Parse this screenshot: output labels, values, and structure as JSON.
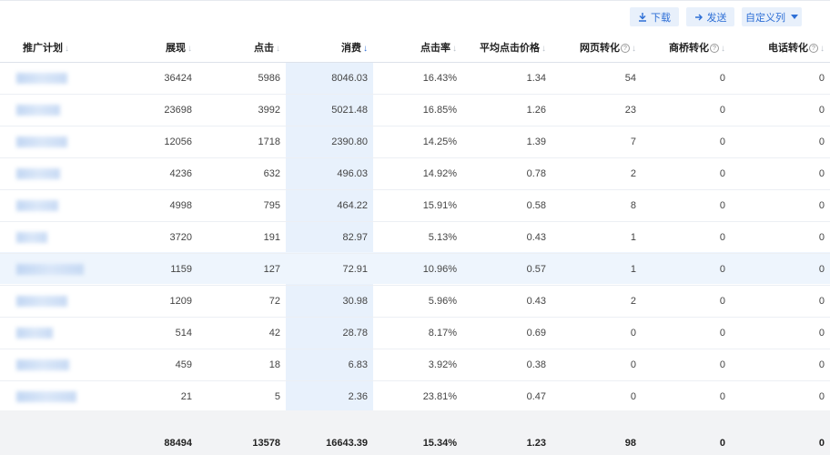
{
  "toolbar": {
    "download_label": "下载",
    "send_label": "发送",
    "custom_label": "自定义列"
  },
  "columns": [
    {
      "label": "推广计划",
      "help": false,
      "sort": "none"
    },
    {
      "label": "展现",
      "help": false,
      "sort": "none"
    },
    {
      "label": "点击",
      "help": false,
      "sort": "none"
    },
    {
      "label": "消费",
      "help": false,
      "sort": "desc"
    },
    {
      "label": "点击率",
      "help": false,
      "sort": "none"
    },
    {
      "label": "平均点击价格",
      "help": false,
      "sort": "none"
    },
    {
      "label": "网页转化",
      "help": true,
      "sort": "none"
    },
    {
      "label": "商桥转化",
      "help": true,
      "sort": "none"
    },
    {
      "label": "电话转化",
      "help": true,
      "sort": "none"
    }
  ],
  "rows": [
    [
      "",
      "36424",
      "5986",
      "8046.03",
      "16.43%",
      "1.34",
      "54",
      "0",
      "0"
    ],
    [
      "",
      "23698",
      "3992",
      "5021.48",
      "16.85%",
      "1.26",
      "23",
      "0",
      "0"
    ],
    [
      "",
      "12056",
      "1718",
      "2390.80",
      "14.25%",
      "1.39",
      "7",
      "0",
      "0"
    ],
    [
      "",
      "4236",
      "632",
      "496.03",
      "14.92%",
      "0.78",
      "2",
      "0",
      "0"
    ],
    [
      "",
      "4998",
      "795",
      "464.22",
      "15.91%",
      "0.58",
      "8",
      "0",
      "0"
    ],
    [
      "",
      "3720",
      "191",
      "82.97",
      "5.13%",
      "0.43",
      "1",
      "0",
      "0"
    ],
    [
      "",
      "1159",
      "127",
      "72.91",
      "10.96%",
      "0.57",
      "1",
      "0",
      "0"
    ],
    [
      "",
      "1209",
      "72",
      "30.98",
      "5.96%",
      "0.43",
      "2",
      "0",
      "0"
    ],
    [
      "",
      "514",
      "42",
      "28.78",
      "8.17%",
      "0.69",
      "0",
      "0",
      "0"
    ],
    [
      "",
      "459",
      "18",
      "6.83",
      "3.92%",
      "0.38",
      "0",
      "0",
      "0"
    ],
    [
      "",
      "21",
      "5",
      "2.36",
      "23.81%",
      "0.47",
      "0",
      "0",
      "0"
    ]
  ],
  "totals": [
    "",
    "88494",
    "13578",
    "16643.39",
    "15.34%",
    "1.23",
    "98",
    "0",
    "0"
  ],
  "colors": {
    "accent": "#2e6fd6",
    "highlight": "#e8f1fc"
  }
}
